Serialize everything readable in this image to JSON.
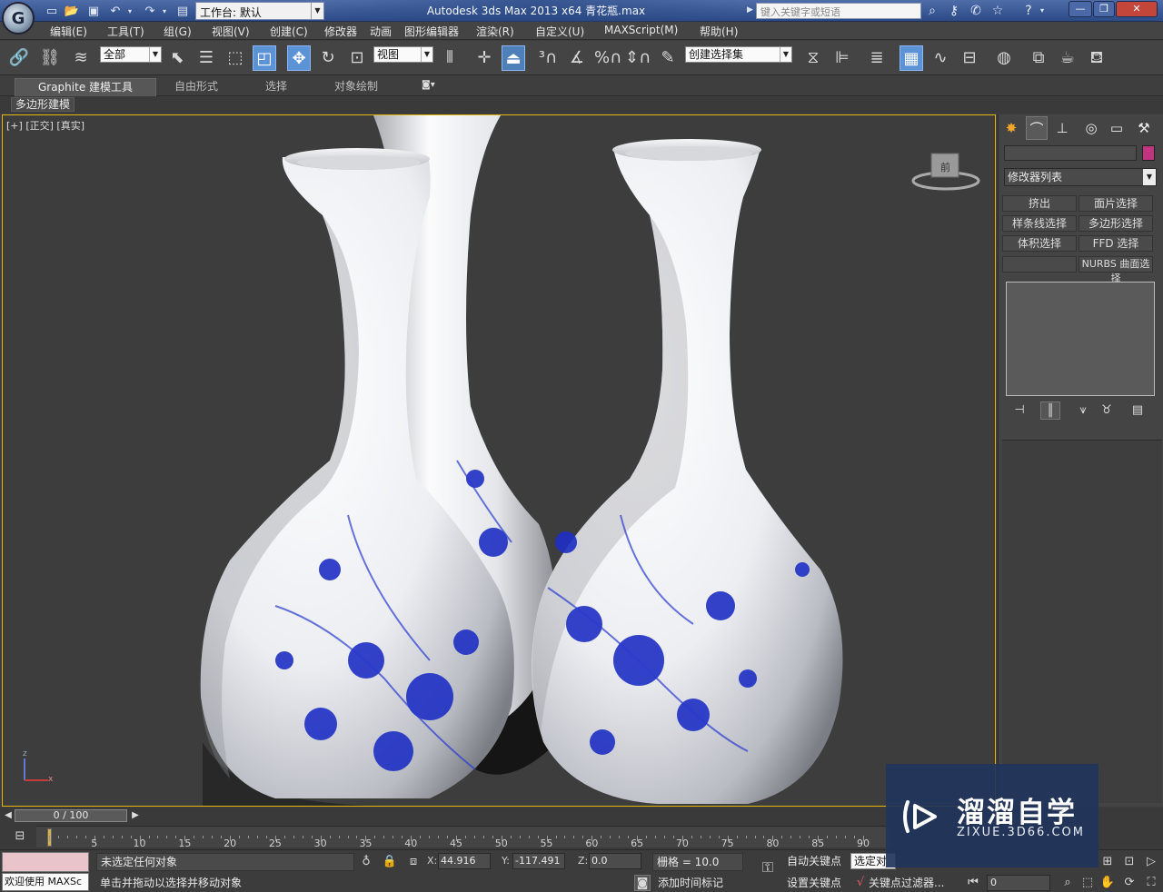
{
  "titlebar": {
    "app_title": "Autodesk 3ds Max  2013 x64      青花瓶.max",
    "workspace_label": "工作台: 默认",
    "search_placeholder": "键入关键字或短语",
    "minimize": "—",
    "restore": "❐",
    "close": "✕"
  },
  "menubar": {
    "items": [
      "编辑(E)",
      "工具(T)",
      "组(G)",
      "视图(V)",
      "创建(C)",
      "修改器",
      "动画",
      "图形编辑器",
      "渲染(R)",
      "自定义(U)",
      "MAXScript(M)",
      "帮助(H)"
    ]
  },
  "toolbar": {
    "selection_filter": "全部",
    "ref_coord": "视图",
    "named_selection": "创建选择集"
  },
  "ribbon": {
    "tabs": [
      "Graphite 建模工具",
      "自由形式",
      "选择",
      "对象绘制"
    ],
    "sub_label": "多边形建模"
  },
  "viewport": {
    "label_plus": "[+]",
    "label_view": "[正交]",
    "label_shading": "[真实]",
    "viewcube_face": "前",
    "axis_x": "x",
    "axis_z": "z"
  },
  "command_panel": {
    "modifier_list": "修改器列表",
    "modifier_buttons": [
      "挤出",
      "面片选择",
      "样条线选择",
      "多边形选择",
      "体积选择",
      "FFD 选择",
      "",
      "NURBS 曲面选择"
    ]
  },
  "timeline": {
    "slider_label": "0 / 100",
    "ticks": [
      "5",
      "10",
      "15",
      "20",
      "25",
      "30",
      "35",
      "40",
      "45",
      "50",
      "55",
      "60",
      "65",
      "70",
      "75",
      "80",
      "85",
      "90"
    ]
  },
  "statusbar": {
    "maxscript": "欢迎使用 MAXSc",
    "selection_status": "未选定任何对象",
    "prompt": "单击并拖动以选择并移动对象",
    "x_label": "X:",
    "x_value": "44.916",
    "y_label": "Y:",
    "y_value": "-117.491",
    "z_label": "Z:",
    "z_value": "0.0",
    "grid": "栅格 = 10.0",
    "add_time_tag": "添加时间标记",
    "auto_key": "自动关键点",
    "set_key": "设置关键点",
    "selected_dropdown": "选定对",
    "key_filters": "关键点过滤器...",
    "frame_value": "0"
  },
  "watermark": {
    "title": "溜溜自学",
    "url": "ZIXUE.3D66.COM"
  },
  "colors": {
    "viewport_border": "#e6b800",
    "titlebar": "#2b4a86",
    "active_tool": "#5c93d6",
    "object_color": "#c0357f",
    "porcelain_blue": "#1e2fc4"
  }
}
